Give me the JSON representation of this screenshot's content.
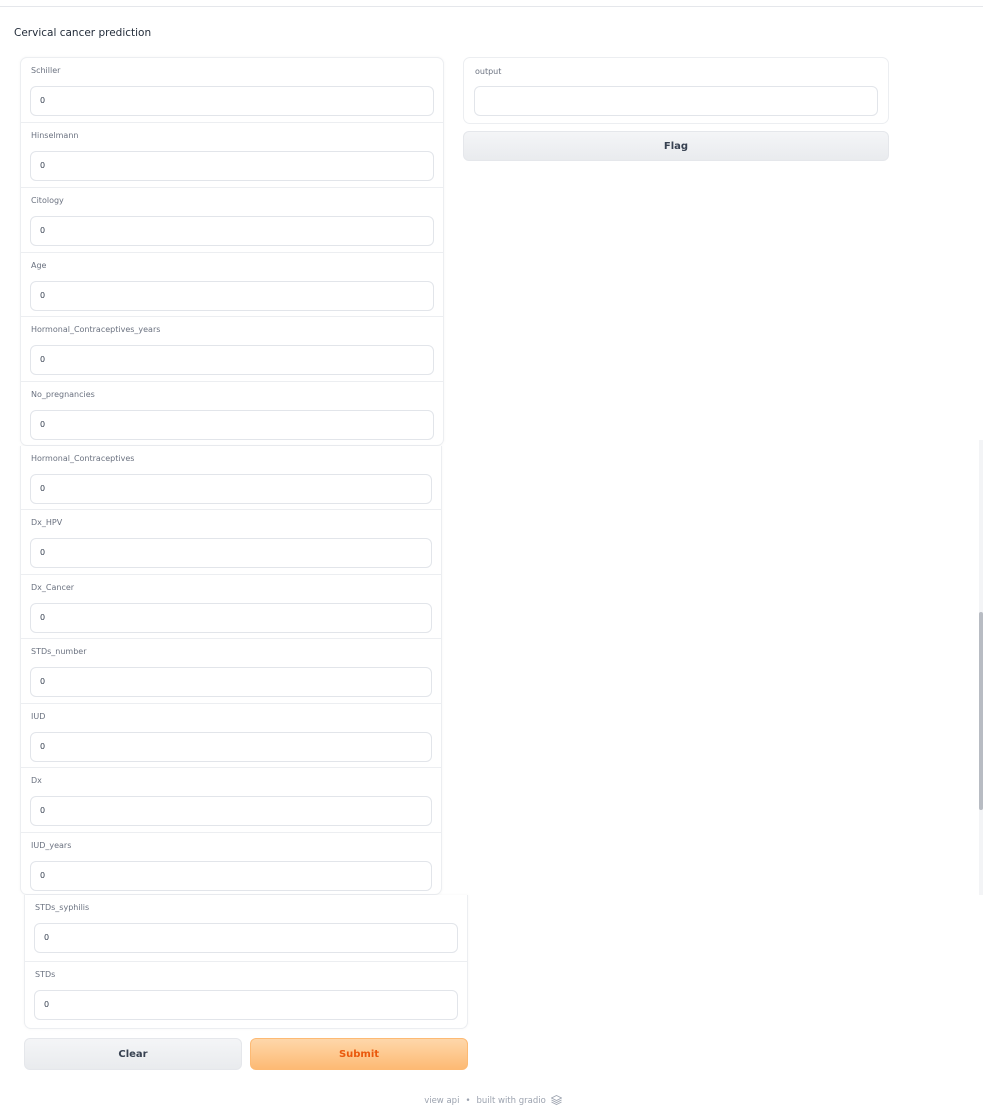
{
  "app": {
    "title": "Cervical cancer prediction"
  },
  "inputs_group_a": [
    {
      "label": "Schiller",
      "value": "0"
    },
    {
      "label": "Hinselmann",
      "value": "0"
    },
    {
      "label": "Citology",
      "value": "0"
    },
    {
      "label": "Age",
      "value": "0"
    },
    {
      "label": "Hormonal_Contraceptives_years",
      "value": "0"
    },
    {
      "label": "No_pregnancies",
      "value": "0"
    }
  ],
  "inputs_group_b": [
    {
      "label": "Hormonal_Contraceptives",
      "value": "0"
    },
    {
      "label": "Dx_HPV",
      "value": "0"
    },
    {
      "label": "Dx_Cancer",
      "value": "0"
    },
    {
      "label": "STDs_number",
      "value": "0"
    },
    {
      "label": "IUD",
      "value": "0"
    },
    {
      "label": "Dx",
      "value": "0"
    },
    {
      "label": "IUD_years",
      "value": "0"
    }
  ],
  "inputs_group_c": [
    {
      "label": "STDs_syphilis",
      "value": "0"
    },
    {
      "label": "STDs",
      "value": "0"
    }
  ],
  "output": {
    "label": "output",
    "value": ""
  },
  "buttons": {
    "flag": "Flag",
    "clear": "Clear",
    "submit": "Submit"
  },
  "footer": {
    "view_api": "view api",
    "separator": "•",
    "built_with": "built with gradio"
  },
  "icons": {
    "footer_logo": "gradio-logo-icon"
  },
  "colors": {
    "submit_bg": "#fdba74",
    "submit_text": "#ea580c",
    "accent_border": "#e5e7eb"
  }
}
